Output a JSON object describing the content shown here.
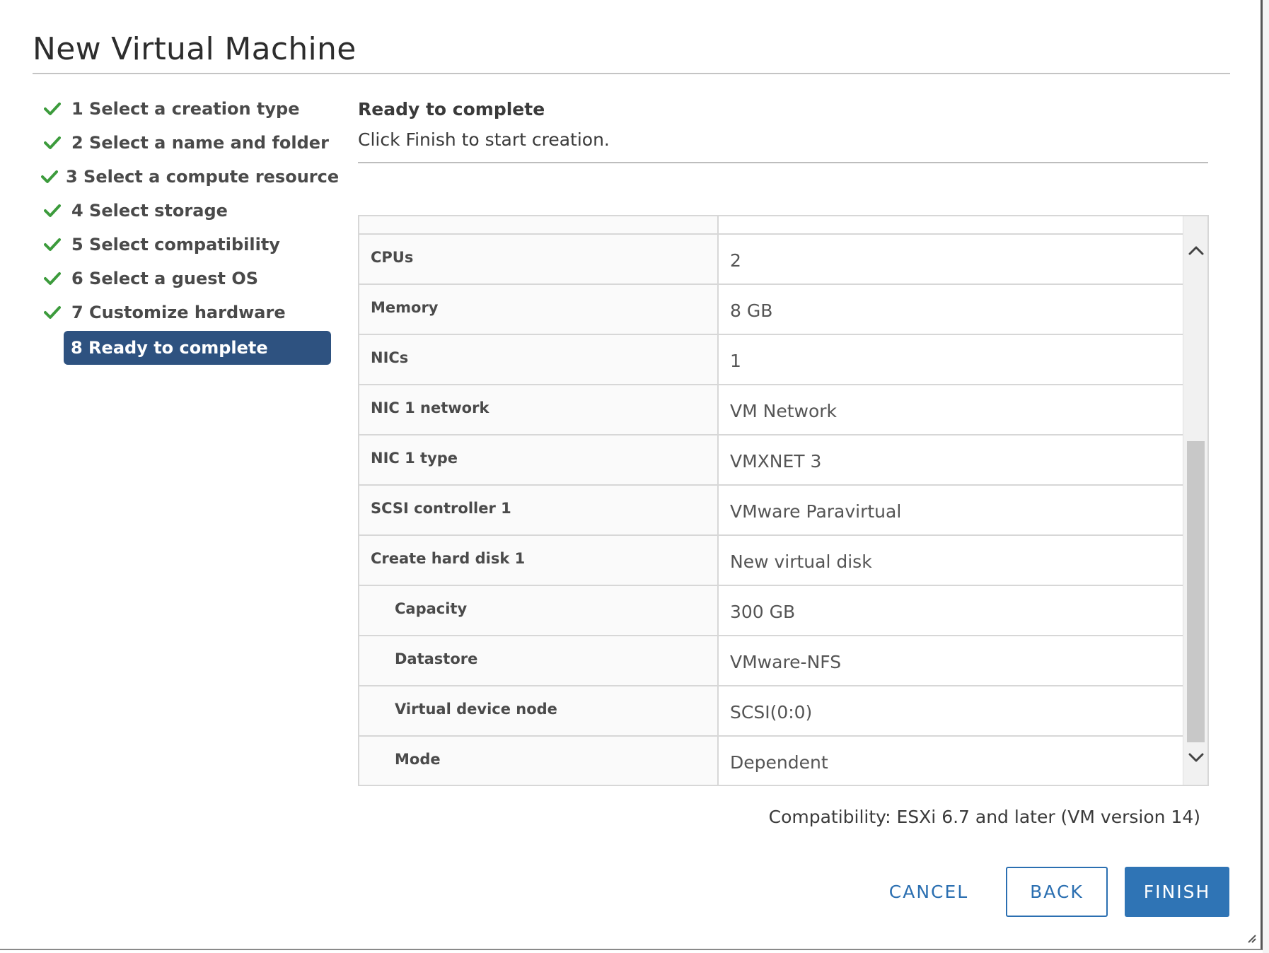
{
  "dialog": {
    "title": "New Virtual Machine"
  },
  "steps": [
    {
      "label": "1 Select a creation type",
      "done": true
    },
    {
      "label": "2 Select a name and folder",
      "done": true
    },
    {
      "label": "3 Select a compute resource",
      "done": true
    },
    {
      "label": "4 Select storage",
      "done": true
    },
    {
      "label": "5 Select compatibility",
      "done": true
    },
    {
      "label": "6 Select a guest OS",
      "done": true
    },
    {
      "label": "7 Customize hardware",
      "done": true
    },
    {
      "label": "8 Ready to complete",
      "done": false,
      "active": true
    }
  ],
  "content": {
    "title": "Ready to complete",
    "subtitle": "Click Finish to start creation."
  },
  "summary_rows": [
    {
      "key": "CPUs",
      "value": "2"
    },
    {
      "key": "Memory",
      "value": "8 GB"
    },
    {
      "key": "NICs",
      "value": "1"
    },
    {
      "key": "NIC 1 network",
      "value": "VM Network"
    },
    {
      "key": "NIC 1 type",
      "value": "VMXNET 3"
    },
    {
      "key": "SCSI controller 1",
      "value": "VMware Paravirtual"
    },
    {
      "key": "Create hard disk 1",
      "value": "New virtual disk"
    },
    {
      "key": "Capacity",
      "value": "300 GB"
    },
    {
      "key": "Datastore",
      "value": "VMware-NFS"
    },
    {
      "key": "Virtual device node",
      "value": "SCSI(0:0)"
    },
    {
      "key": "Mode",
      "value": "Dependent"
    }
  ],
  "compatibility": "Compatibility: ESXi 6.7 and later (VM version 14)",
  "buttons": {
    "cancel": "CANCEL",
    "back": "BACK",
    "finish": "FINISH"
  },
  "colors": {
    "accent": "#2f74b5",
    "active_step": "#2e5280",
    "check": "#3c9b3c"
  },
  "icons": {
    "step_done": "checkmark-icon",
    "scroll_up": "chevron-up-icon",
    "scroll_down": "chevron-down-icon",
    "resize": "resize-grip-icon"
  }
}
